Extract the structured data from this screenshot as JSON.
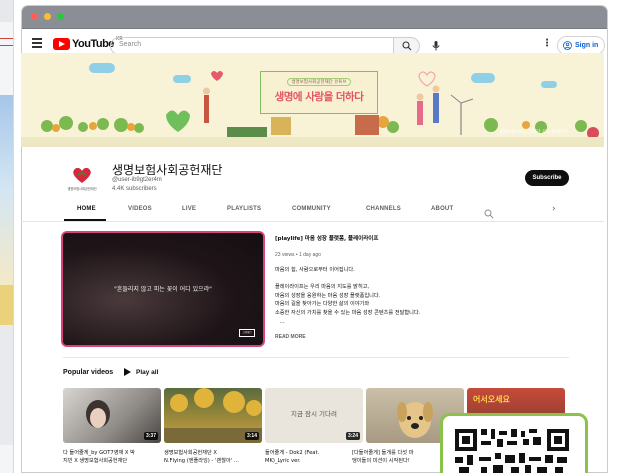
{
  "youtube": {
    "logo_text": "YouTube",
    "logo_region": "KR",
    "search_placeholder": "Search",
    "signin_label": "Sign in"
  },
  "banner": {
    "sign_subtitle": "생명보험사회공헌재단 유튜브",
    "sign_title": "생명에 사랑을 더하다",
    "caption": "생명보험사회공헌재단 공식 홈페이지"
  },
  "channel": {
    "name": "생명보험사회공헌재단",
    "handle": "@user-ib9gt2er4m",
    "subscribers": "4.4K subscribers",
    "avatar_caption": "생명보험사회공헌재단",
    "subscribe_label": "Subscribe"
  },
  "tabs": [
    {
      "label": "HOME",
      "active": true
    },
    {
      "label": "VIDEOS",
      "active": false
    },
    {
      "label": "LIVE",
      "active": false
    },
    {
      "label": "PLAYLISTS",
      "active": false
    },
    {
      "label": "COMMUNITY",
      "active": false
    },
    {
      "label": "CHANNELS",
      "active": false
    },
    {
      "label": "ABOUT",
      "active": false
    }
  ],
  "featured": {
    "thumb_caption": "\"흔들리지 않고 피는 꽃이 어디 있으랴\"",
    "thumb_mini": "고영희단",
    "title": "[playlife] 마음 성장 플랫폼, 플레이라이프",
    "meta": "23 views • 1 day ago",
    "description": [
      "마음의 힘, 사람으로부터 이어집니다.",
      "ㅤ",
      "플레이라이프는 우리 마음의 지도를 밝히고,",
      "마음의 성장을 응원하는 마음 성장 플랫폼입니다.",
      "마음의 길을 찾아가는 다양한 삶의 이야기와",
      "소중한 자신의 가치를 찾을 수 있는 마음 성장 콘텐츠를 전달합니다.",
      "ㅤ..."
    ],
    "read_more": "READ MORE"
  },
  "popular": {
    "title": "Popular videos",
    "play_all_label": "Play all",
    "videos": [
      {
        "duration": "3:37",
        "title_lines": [
          "다 들어줄게_by GOT7영재 X 박",
          "지민 X 생명보험사회공헌재단"
        ]
      },
      {
        "duration": "3:14",
        "title_lines": [
          "생명보험사회공헌재단 X",
          "N.Flying (엔플라잉) - '괜찮아' ..."
        ]
      },
      {
        "duration": "3:24",
        "title_lines": [
          "들어줄게 - Dok2 (Feat.",
          "MK)_Lyric ver."
        ],
        "thumb_text": "지금 잠시 기다려"
      },
      {
        "duration": "",
        "title_lines": [
          "[다들어줄게] 들개를 다섯 마",
          "댕이들의 미션이 시작된다!"
        ]
      },
      {
        "duration": "",
        "title_lines": [],
        "thumb_text": "어서오세요"
      }
    ]
  },
  "colors": {
    "youtube_red": "#ff0000",
    "link_blue": "#065fd4",
    "featured_border": "#d9437d",
    "qr_border": "#8bc34a",
    "banner_bg": "#f8f2d6",
    "banner_title": "#e65266"
  }
}
